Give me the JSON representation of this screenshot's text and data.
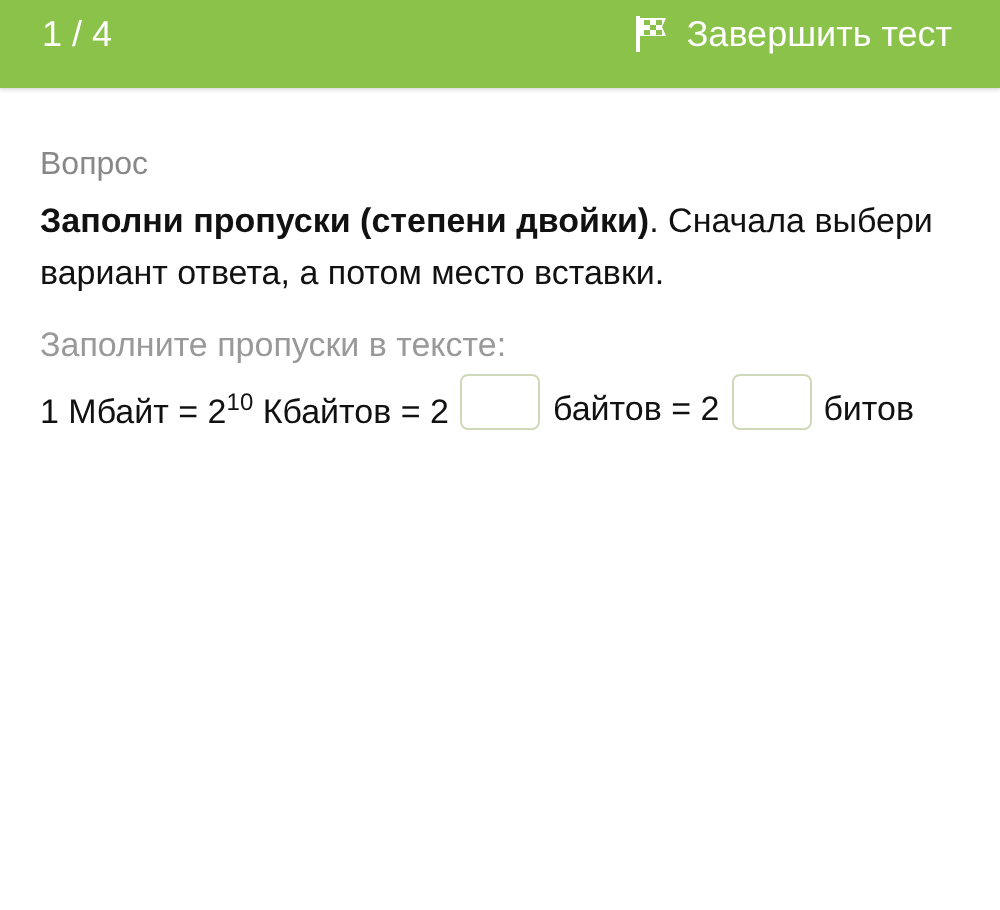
{
  "header": {
    "progress": "1 / 4",
    "finish_button": "Завершить тест"
  },
  "question": {
    "label": "Вопрос",
    "text": "**Заполни пропуски (степени двойки)**. Сначала выбери вариант ответа, а потом место вставки.",
    "hint": "Заполните пропуски в тексте:",
    "equation": [
      {
        "kind": "text",
        "text": "1 Мбайт = 2$^{10}$ Кбайтов = 2"
      },
      {
        "kind": "blank"
      },
      {
        "kind": "text",
        "text": "байтов = 2"
      },
      {
        "kind": "blank"
      },
      {
        "kind": "text",
        "text": "битов"
      }
    ]
  }
}
